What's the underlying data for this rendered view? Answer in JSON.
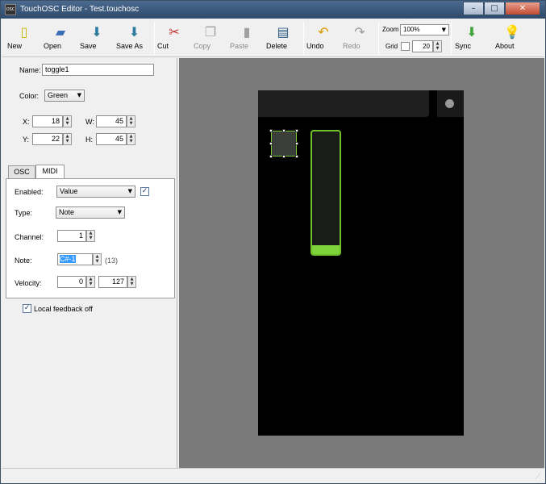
{
  "window": {
    "title": "TouchOSC Editor - Test.touchosc",
    "app_icon_text": "OSC"
  },
  "toolbar": {
    "new": "New",
    "open": "Open",
    "save": "Save",
    "save_as": "Save As",
    "cut": "Cut",
    "copy": "Copy",
    "paste": "Paste",
    "delete": "Delete",
    "undo": "Undo",
    "redo": "Redo",
    "sync": "Sync",
    "about": "About",
    "zoom_label": "Zoom",
    "zoom_value": "100%",
    "grid_label": "Grid",
    "grid_value": "20"
  },
  "properties": {
    "name_label": "Name:",
    "name_value": "toggle1",
    "color_label": "Color:",
    "color_value": "Green",
    "x_label": "X:",
    "x_value": "18",
    "y_label": "Y:",
    "y_value": "22",
    "w_label": "W:",
    "w_value": "45",
    "h_label": "H:",
    "h_value": "45"
  },
  "tabs": [
    "OSC",
    "MIDI"
  ],
  "midi": {
    "enabled_label": "Enabled:",
    "enabled_value": "Value",
    "type_label": "Type:",
    "type_value": "Note",
    "channel_label": "Channel:",
    "channel_value": "1",
    "note_label": "Note:",
    "note_value": "C#-1",
    "note_number": "(13)",
    "velocity_label": "Velocity:",
    "velocity_min": "0",
    "velocity_max": "127"
  },
  "local_feedback_label": "Local feedback off",
  "canvas": {
    "accent_color": "#7dd33a",
    "fader_level": 0.07
  }
}
